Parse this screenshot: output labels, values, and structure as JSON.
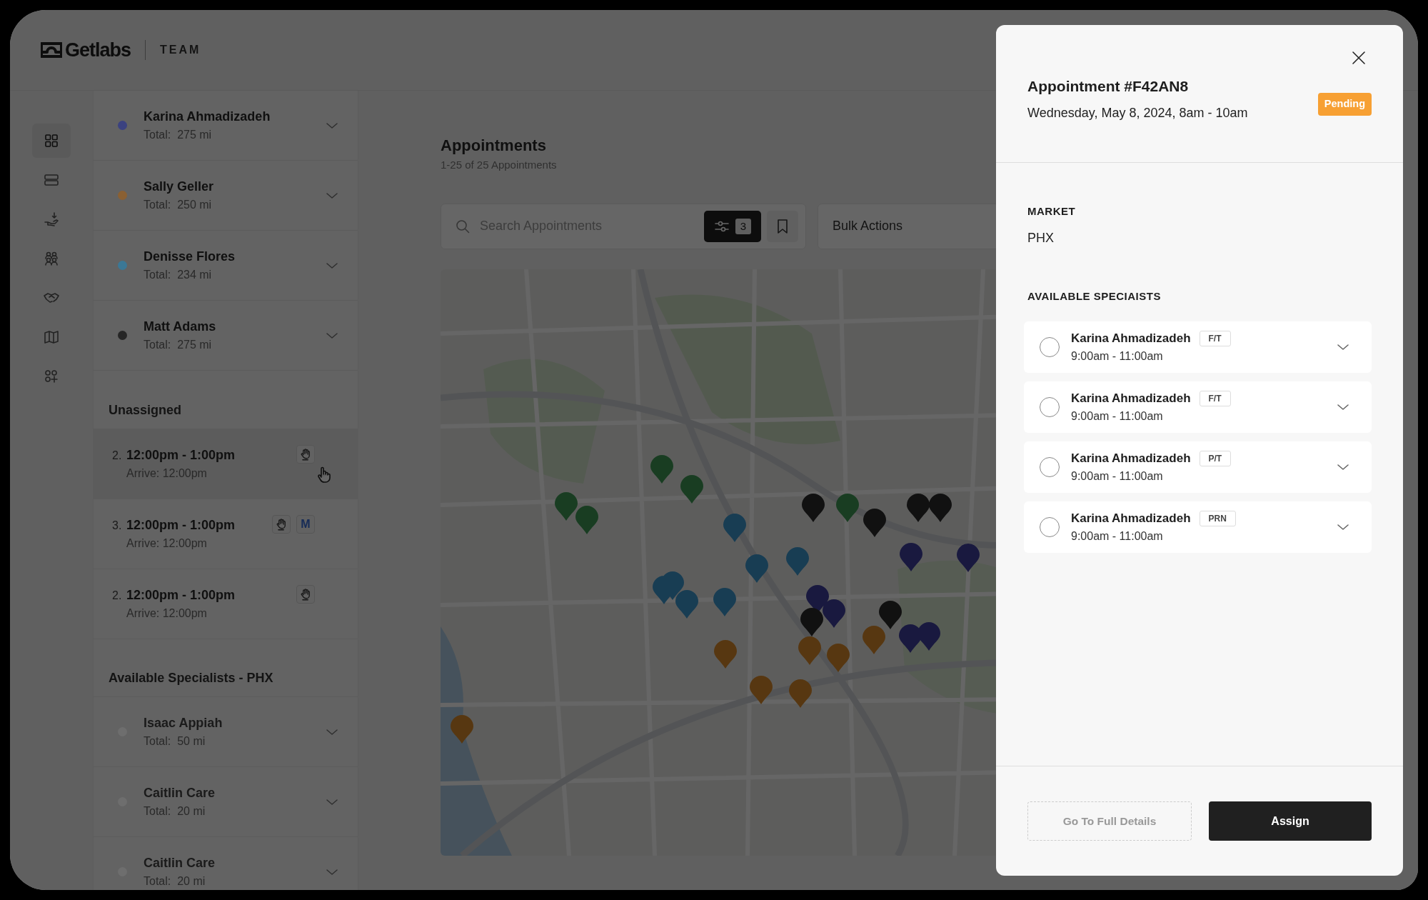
{
  "brand": {
    "logo": "Getlabs",
    "section": "TEAM"
  },
  "nav_rail": [
    {
      "selected": true
    },
    {
      "selected": false
    },
    {
      "selected": false
    },
    {
      "selected": false
    },
    {
      "selected": false
    },
    {
      "selected": false
    },
    {
      "selected": false
    }
  ],
  "specialists": [
    {
      "name": "Karina Ahmadizadeh",
      "total": "Total:  275 mi",
      "color": "#3b4280"
    },
    {
      "name": "Sally Geller",
      "total": "Total:  250 mi",
      "color": "#8a6033"
    },
    {
      "name": "Denisse Flores",
      "total": "Total:  234 mi",
      "color": "#3b7896"
    },
    {
      "name": "Matt Adams",
      "total": "Total:  275 mi",
      "color": "#262626"
    }
  ],
  "unassigned": {
    "heading": "Unassigned",
    "items": [
      {
        "number": "2.",
        "time": "12:00pm - 1:00pm",
        "arrive": "Arrive: 12:00pm",
        "selected": true,
        "tags": [
          {
            "kind": "icon"
          }
        ]
      },
      {
        "number": "3.",
        "time": "12:00pm - 1:00pm",
        "arrive": "Arrive: 12:00pm",
        "selected": false,
        "tags": [
          {
            "kind": "icon"
          },
          {
            "kind": "letter",
            "label": "M"
          }
        ]
      },
      {
        "number": "2.",
        "time": "12:00pm - 1:00pm",
        "arrive": "Arrive: 12:00pm",
        "selected": false,
        "tags": [
          {
            "kind": "icon"
          }
        ]
      }
    ]
  },
  "available": {
    "heading": "Available Specialists - PHX",
    "items": [
      {
        "name": "Isaac Appiah",
        "total": "Total:  50 mi",
        "color": "#6e6e6e"
      },
      {
        "name": "Caitlin Care",
        "total": "Total:  20 mi",
        "color": "#6e6e6e"
      },
      {
        "name": "Caitlin Care",
        "total": "Total:  20 mi",
        "color": "#6e6e6e"
      }
    ]
  },
  "main": {
    "title": "Appointments",
    "subtitle": "1-25 of 25 Appointments",
    "search": {
      "placeholder": "Search Appointments"
    },
    "filter_count": "3",
    "bulk_actions": "Bulk Actions"
  },
  "drawer": {
    "title": "Appointment #F42AN8",
    "datetime": "Wednesday, May 8, 2024, 8am - 10am",
    "status": "Pending",
    "market_label": "MARKET",
    "market": "PHX",
    "options_heading": "AVAILABLE SPECIAISTS",
    "options": [
      {
        "name": "Karina Ahmadizadeh",
        "tag": "F/T",
        "time": "9:00am - 11:00am",
        "selected": false
      },
      {
        "name": "Karina Ahmadizadeh",
        "tag": "F/T",
        "time": "9:00am - 11:00am",
        "selected": false
      },
      {
        "name": "Karina Ahmadizadeh",
        "tag": "P/T",
        "time": "9:00am - 11:00am",
        "selected": false
      },
      {
        "name": "Karina Ahmadizadeh",
        "tag": "PRN",
        "time": "9:00am - 11:00am",
        "selected": false
      }
    ],
    "buttons": [
      {
        "label": "Go To Full Details",
        "kind": "secondary"
      },
      {
        "label": "Assign",
        "kind": "primary"
      }
    ]
  }
}
